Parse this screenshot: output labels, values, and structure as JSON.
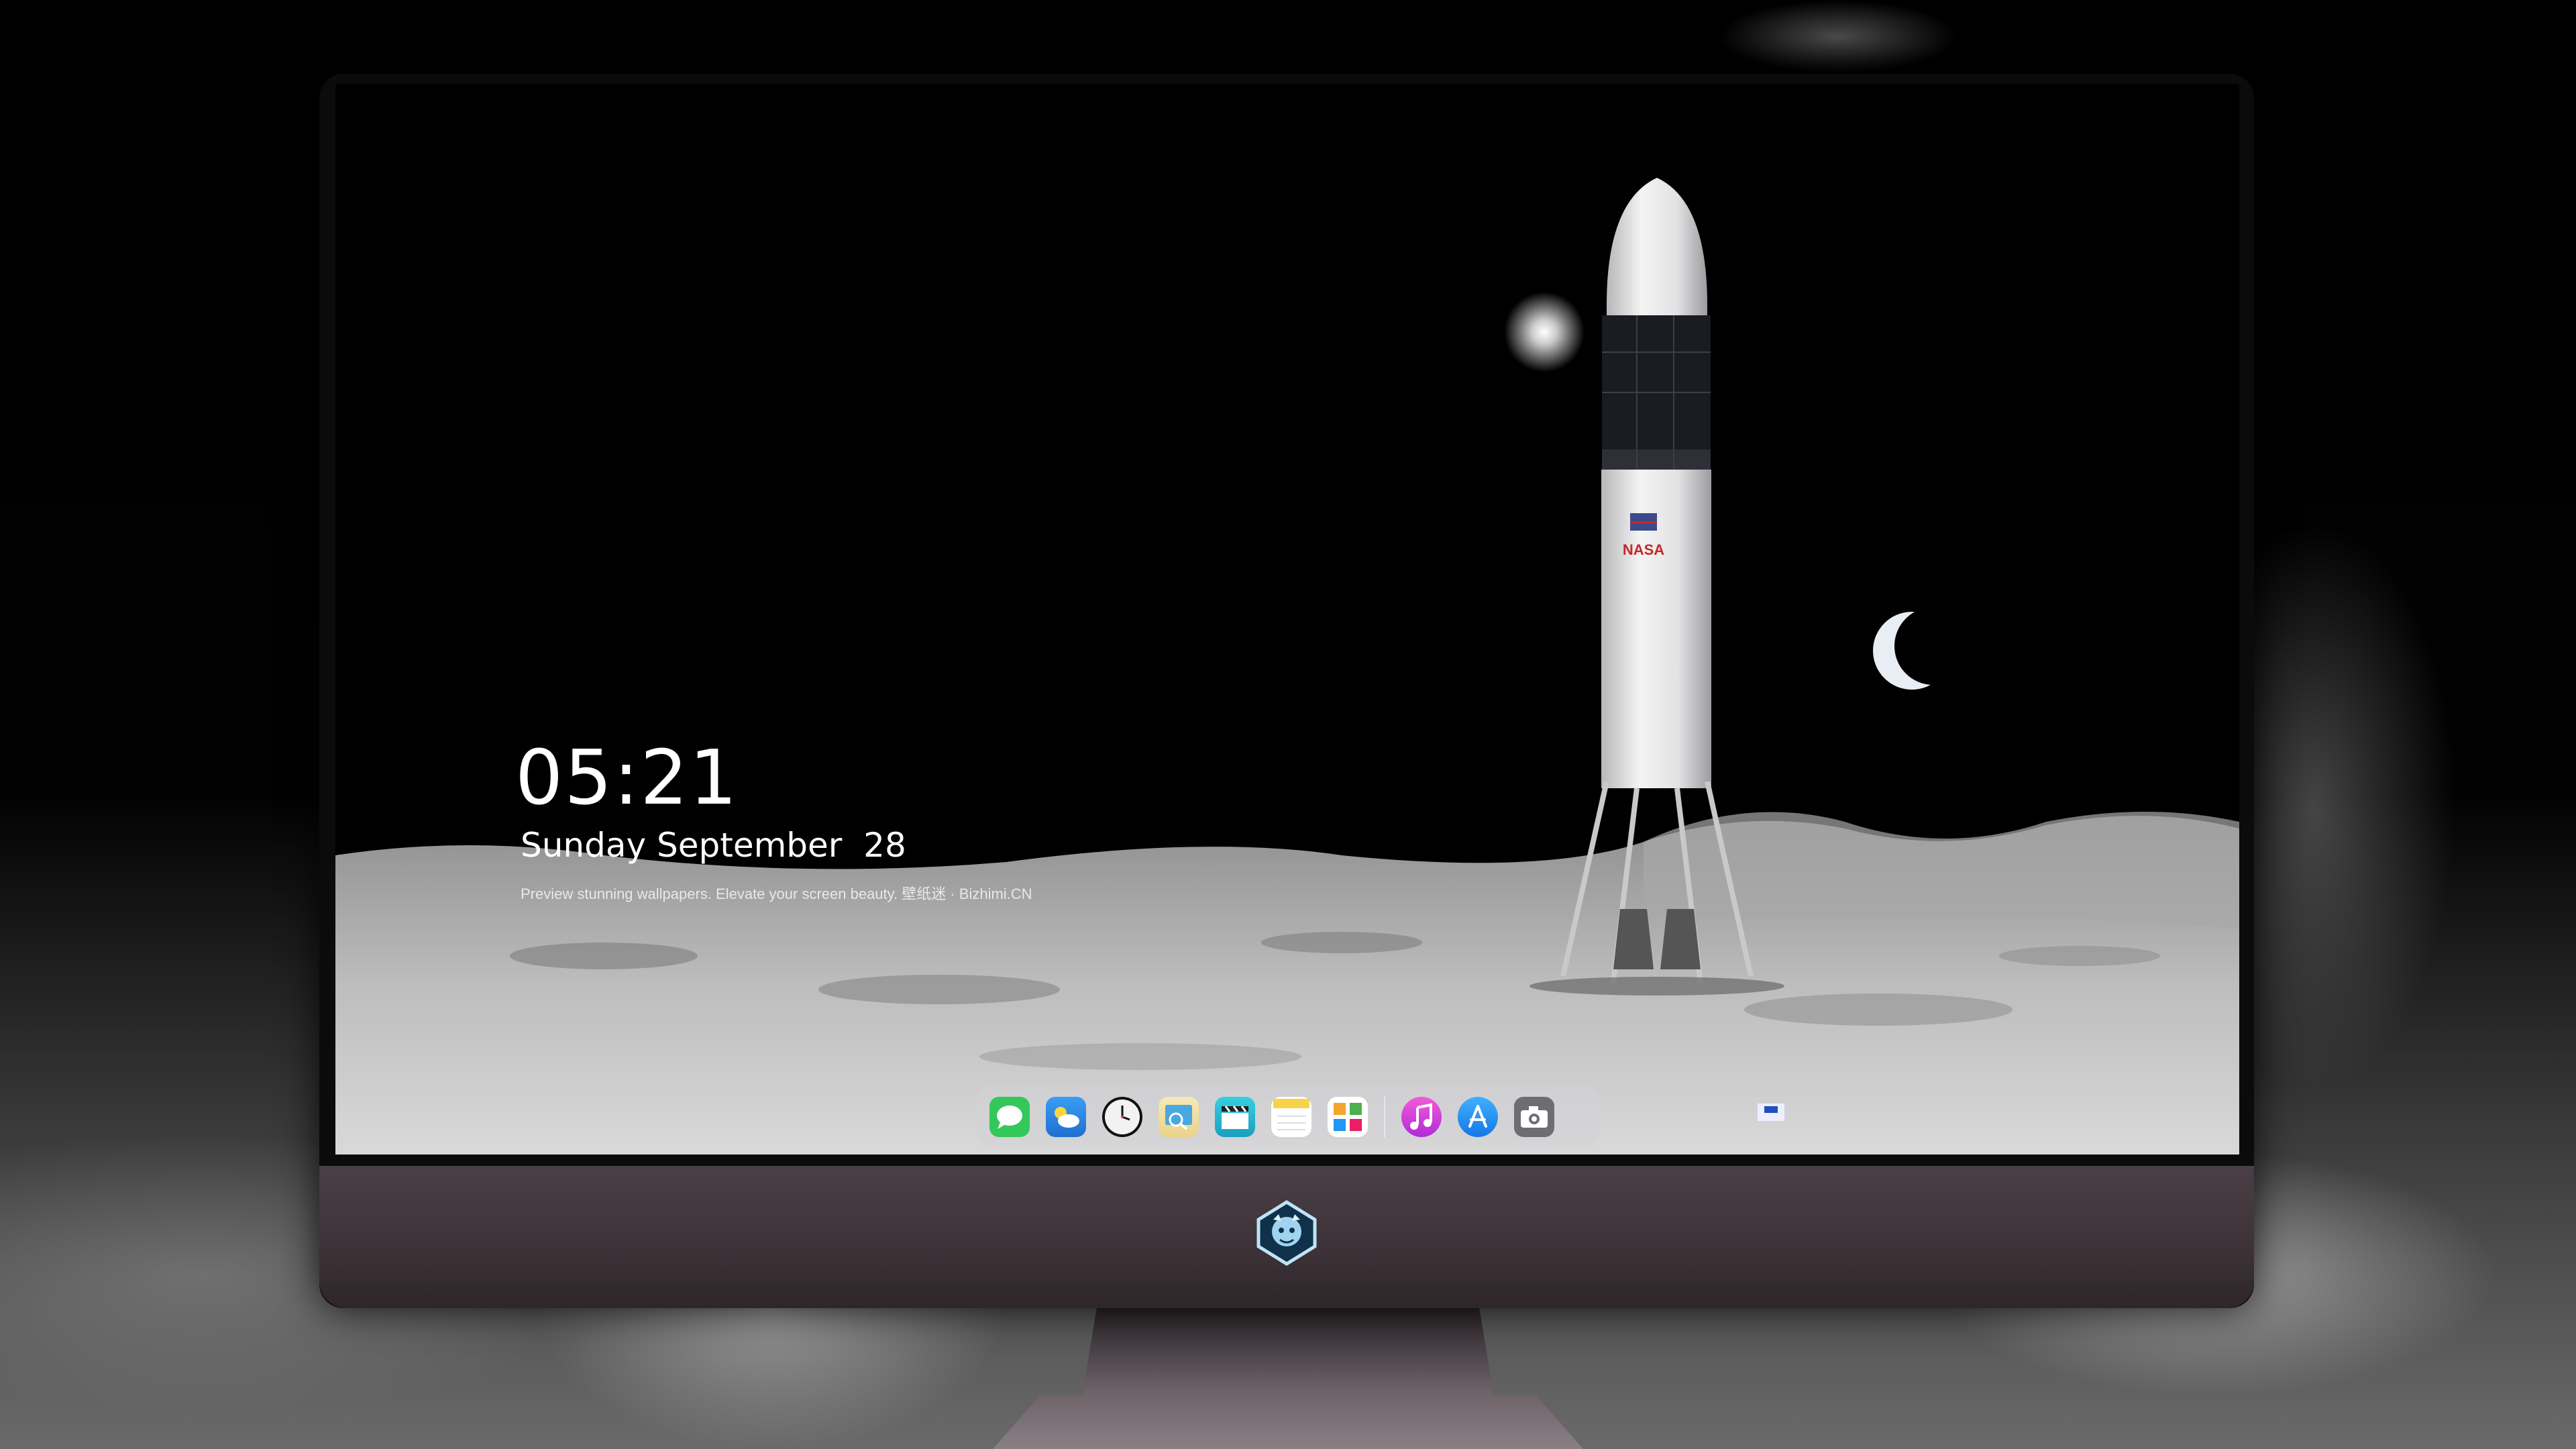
{
  "lockscreen": {
    "time": "05:21",
    "date": "Sunday September  28",
    "tagline": "Preview stunning wallpapers. Elevate your screen beauty. 壁纸迷 · Bizhimi.CN"
  },
  "wallpaper": {
    "rocket_flag_text": "NASA"
  },
  "dock": {
    "apps": [
      {
        "name": "messages-icon",
        "color": "#34c759"
      },
      {
        "name": "weather-icon",
        "color": "#3a9df5"
      },
      {
        "name": "clock-icon",
        "color": "#f2f2f2"
      },
      {
        "name": "preview-icon",
        "color": "#4aa8e0"
      },
      {
        "name": "clips-icon",
        "color": "#1fb7c9"
      },
      {
        "name": "notes-icon",
        "color": "#f7d34a"
      },
      {
        "name": "photos-icon",
        "color": "#ffffff"
      },
      {
        "name": "music-icon",
        "color": "#d63ad8"
      },
      {
        "name": "app-store-icon",
        "color": "#1e88f5"
      },
      {
        "name": "camera-icon",
        "color": "#6e6e72"
      }
    ]
  }
}
